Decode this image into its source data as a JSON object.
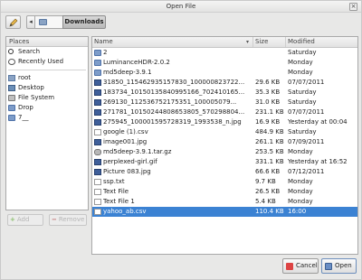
{
  "window": {
    "title": "Open File",
    "close_glyph": "×"
  },
  "pathbar": {
    "edit_icon": "pencil-icon",
    "back_glyph": "◂",
    "current_folder": "Downloads"
  },
  "places": {
    "header": "Places",
    "items": [
      {
        "label": "Search",
        "icon": "search-icon"
      },
      {
        "label": "Recently Used",
        "icon": "recent-icon"
      },
      {
        "label": "root",
        "icon": "home-folder-icon"
      },
      {
        "label": "Desktop",
        "icon": "desktop-icon"
      },
      {
        "label": "File System",
        "icon": "drive-icon"
      },
      {
        "label": "Drop",
        "icon": "folder-icon"
      },
      {
        "label": "7__",
        "icon": "folder-icon"
      }
    ],
    "add_label": "Add",
    "remove_label": "Remove"
  },
  "files": {
    "columns": {
      "name": "Name",
      "size": "Size",
      "modified": "Modified"
    },
    "sort_glyph": "▾",
    "rows": [
      {
        "name": "2",
        "size": "",
        "modified": "Saturday",
        "kind": "folder"
      },
      {
        "name": "LuminanceHDR-2.0.2",
        "size": "",
        "modified": "Monday",
        "kind": "folder"
      },
      {
        "name": "md5deep-3.9.1",
        "size": "",
        "modified": "Monday",
        "kind": "folder"
      },
      {
        "name": "31850_115462935157830_100000823722...",
        "size": "29.6 KB",
        "modified": "07/07/2011",
        "kind": "img"
      },
      {
        "name": "183734_1015013584099516​6_702410165...",
        "size": "35.3 KB",
        "modified": "Saturday",
        "kind": "img"
      },
      {
        "name": "269130_112536752175351_100005079...",
        "size": "31.0 KB",
        "modified": "Saturday",
        "kind": "img"
      },
      {
        "name": "271781_1015024480865380​5_570298804...",
        "size": "231.1 KB",
        "modified": "07/07/2011",
        "kind": "img"
      },
      {
        "name": "275945_100001595728319_1993538_n.jpg",
        "size": "16.9 KB",
        "modified": "Yesterday at 00:04",
        "kind": "img"
      },
      {
        "name": "google (1).csv",
        "size": "484.9 KB",
        "modified": "Saturday",
        "kind": "csv"
      },
      {
        "name": "image001.jpg",
        "size": "261.1 KB",
        "modified": "07/09/2011",
        "kind": "img"
      },
      {
        "name": "md5deep-3.9.1.tar.gz",
        "size": "253.5 KB",
        "modified": "Monday",
        "kind": "gz"
      },
      {
        "name": "perplexed-girl.gif",
        "size": "331.1 KB",
        "modified": "Yesterday at 16:52",
        "kind": "img"
      },
      {
        "name": "Picture 083.jpg",
        "size": "66.6 KB",
        "modified": "07/12/2011",
        "kind": "img"
      },
      {
        "name": "ssp.txt",
        "size": "9.7 KB",
        "modified": "Monday",
        "kind": "doc"
      },
      {
        "name": "Text File",
        "size": "26.5 KB",
        "modified": "Monday",
        "kind": "doc"
      },
      {
        "name": "Text File 1",
        "size": "5.4 KB",
        "modified": "Monday",
        "kind": "doc"
      },
      {
        "name": "yahoo_ab.csv",
        "size": "110.4 KB",
        "modified": "16:00",
        "kind": "csv",
        "selected": true
      }
    ]
  },
  "buttons": {
    "cancel": "Cancel",
    "open": "Open"
  }
}
